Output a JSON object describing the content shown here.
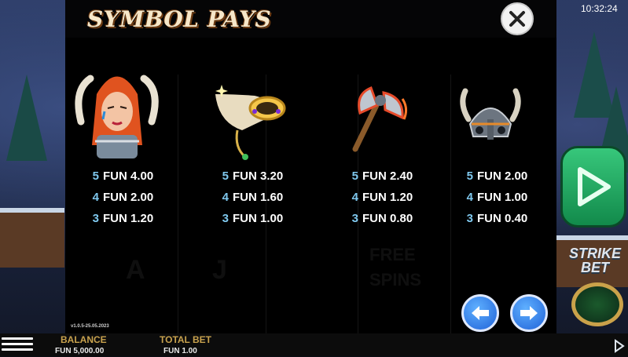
{
  "header": {
    "title": "SYMBOL PAYS",
    "clock": "10:32:24"
  },
  "side": {
    "strike_bet_label": "STRIKE BET"
  },
  "ghost_text": {
    "free": "FREE",
    "spins": "SPINS",
    "letter_a": "A",
    "letter_j": "J"
  },
  "symbols": [
    {
      "name": "warrior-woman",
      "pays": [
        {
          "count": "5",
          "amount": "FUN 4.00"
        },
        {
          "count": "4",
          "amount": "FUN 2.00"
        },
        {
          "count": "3",
          "amount": "FUN 1.20"
        }
      ]
    },
    {
      "name": "drinking-horn",
      "pays": [
        {
          "count": "5",
          "amount": "FUN 3.20"
        },
        {
          "count": "4",
          "amount": "FUN 1.60"
        },
        {
          "count": "3",
          "amount": "FUN 1.00"
        }
      ]
    },
    {
      "name": "battle-axe",
      "pays": [
        {
          "count": "5",
          "amount": "FUN 2.40"
        },
        {
          "count": "4",
          "amount": "FUN 1.20"
        },
        {
          "count": "3",
          "amount": "FUN 0.80"
        }
      ]
    },
    {
      "name": "viking-helmet",
      "pays": [
        {
          "count": "5",
          "amount": "FUN 2.00"
        },
        {
          "count": "4",
          "amount": "FUN 1.00"
        },
        {
          "count": "3",
          "amount": "FUN 0.40"
        }
      ]
    }
  ],
  "version": "v1.0.5-25.05.2023",
  "bottom": {
    "balance_label": "BALANCE",
    "balance_value": "FUN 5,000.00",
    "total_bet_label": "TOTAL BET",
    "total_bet_value": "FUN 1.00"
  },
  "icons": {
    "close": "close-icon",
    "prev": "arrow-left-icon",
    "next": "arrow-right-icon",
    "menu": "hamburger-menu-icon",
    "spin": "play-icon"
  },
  "colors": {
    "accent_blue": "#2a7cf0",
    "label_gold": "#c8a24e",
    "count_blue": "#7fc8ee",
    "spin_green": "#1faa5e"
  }
}
